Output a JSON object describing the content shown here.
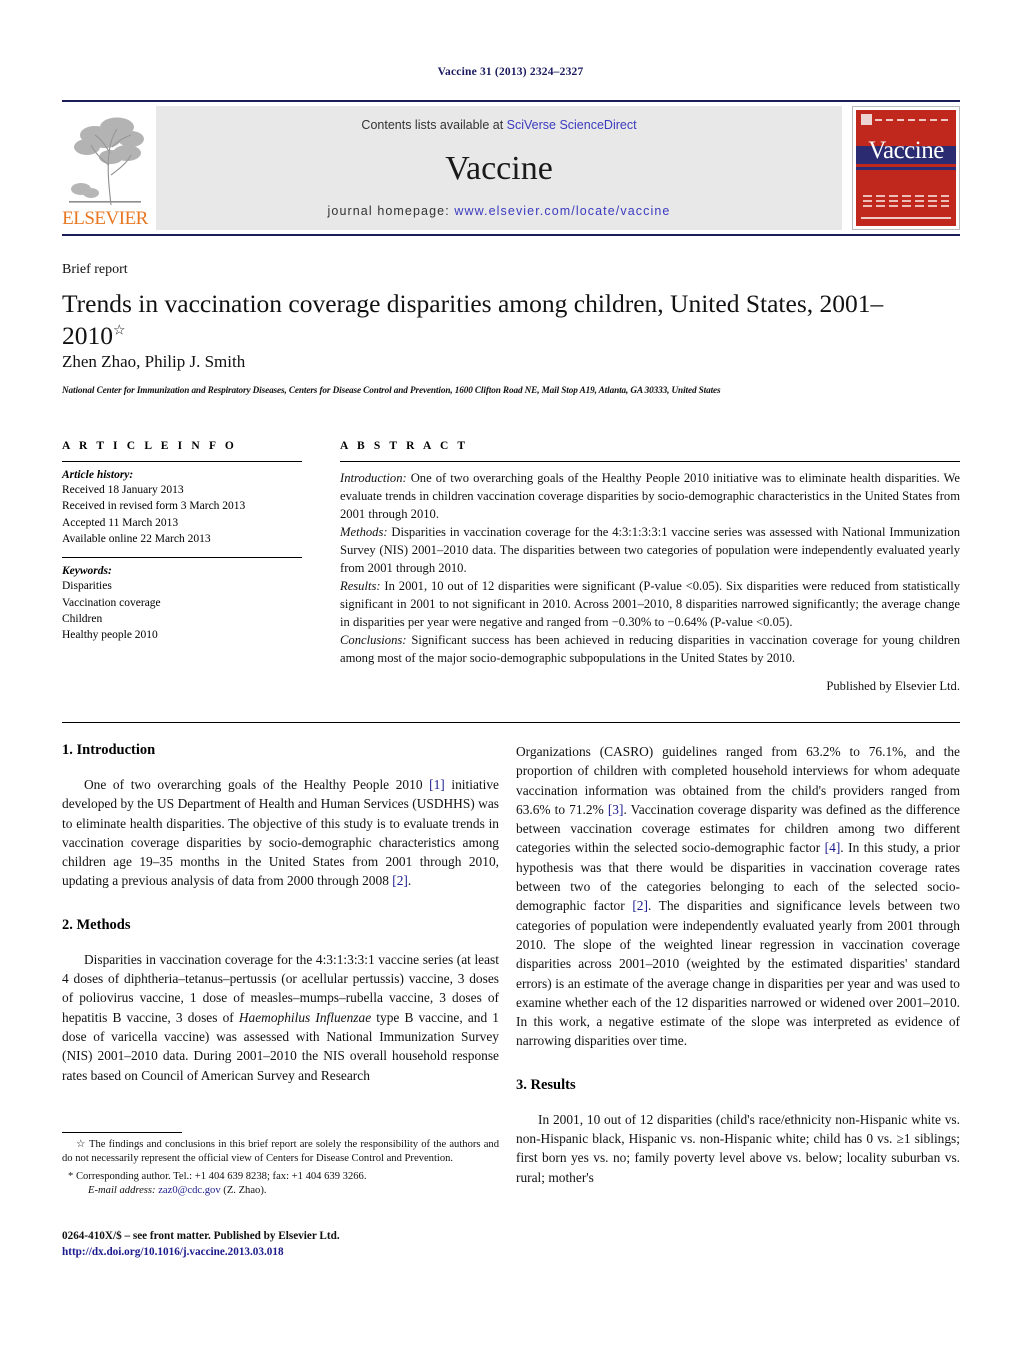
{
  "running_head": "Vaccine 31 (2013) 2324–2327",
  "masthead": {
    "publisher_wordmark": "ELSEVIER",
    "contents_prefix": "Contents lists available at ",
    "contents_link": "SciVerse ScienceDirect",
    "journal_name": "Vaccine",
    "homepage_prefix": "journal homepage: ",
    "homepage_url": "www.elsevier.com/locate/vaccine",
    "cover_title": "Vaccine",
    "accent_red": "#C0281E",
    "accent_navy": "#2b2b72",
    "accent_orange": "#E87722",
    "link_blue": "#3b3bbf"
  },
  "article": {
    "type_label": "Brief report",
    "title": "Trends in vaccination coverage disparities among children, United States, 2001–2010",
    "title_footnote_marker": "☆",
    "authors": "Zhen Zhao, Philip J. Smith",
    "author_marker": "*",
    "affiliation": "National Center for Immunization and Respiratory Diseases, Centers for Disease Control and Prevention, 1600 Clifton Road NE, Mail Stop A19, Atlanta, GA 30333, United States"
  },
  "article_info": {
    "heading": "A R T I C L E   I N F O",
    "history_label": "Article history:",
    "history": [
      "Received 18 January 2013",
      "Received in revised form 3 March 2013",
      "Accepted 11 March 2013",
      "Available online 22 March 2013"
    ],
    "keywords_label": "Keywords:",
    "keywords": [
      "Disparities",
      "Vaccination coverage",
      "Children",
      "Healthy people 2010"
    ]
  },
  "abstract": {
    "heading": "A B S T R A C T",
    "introduction_label": "Introduction:",
    "introduction_text": " One of two overarching goals of the Healthy People 2010 initiative was to eliminate health disparities. We evaluate trends in children vaccination coverage disparities by socio-demographic characteristics in the United States from 2001 through 2010.",
    "methods_label": "Methods:",
    "methods_text": " Disparities in vaccination coverage for the 4:3:1:3:3:1 vaccine series was assessed with National Immunization Survey (NIS) 2001–2010 data. The disparities between two categories of population were independently evaluated yearly from 2001 through 2010.",
    "results_label": "Results:",
    "results_text": " In 2001, 10 out of 12 disparities were significant (P-value <0.05). Six disparities were reduced from statistically significant in 2001 to not significant in 2010. Across 2001–2010, 8 disparities narrowed significantly; the average change in disparities per year were negative and ranged from −0.30% to −0.64% (P-value <0.05).",
    "conclusions_label": "Conclusions:",
    "conclusions_text": " Significant success has been achieved in reducing disparities in vaccination coverage for young children among most of the major socio-demographic subpopulations in the United States by 2010.",
    "publisher_note": "Published by Elsevier Ltd."
  },
  "sections": {
    "introduction_heading": "1.  Introduction",
    "introduction_p1_a": "One of two overarching goals of the Healthy People 2010 ",
    "introduction_ref1": "[1]",
    "introduction_p1_b": " initiative developed by the US Department of Health and Human Services (USDHHS) was to eliminate health disparities. The objective of this study is to evaluate trends in vaccination coverage disparities by socio-demographic characteristics among children age 19–35 months in the United States from 2001 through 2010, updating a previous analysis of data from 2000 through 2008 ",
    "introduction_ref2": "[2]",
    "introduction_p1_c": ".",
    "methods_heading": "2.  Methods",
    "methods_p1_a": "Disparities in vaccination coverage for the 4:3:1:3:3:1 vaccine series (at least 4 doses of diphtheria–tetanus–pertussis (or acellular pertussis) vaccine, 3 doses of poliovirus vaccine, 1 dose of measles–mumps–rubella vaccine, 3 doses of hepatitis B vaccine, 3 doses of ",
    "methods_p1_italic": "Haemophilus Influenzae",
    "methods_p1_b": " type B vaccine, and 1 dose of varicella vaccine) was assessed with National Immunization Survey (NIS) 2001–2010 data. During 2001–2010 the NIS overall household response rates based on Council of American Survey and Research",
    "right_p1_a": "Organizations (CASRO) guidelines ranged from 63.2% to 76.1%, and the proportion of children with completed household interviews for whom adequate vaccination information was obtained from the child's providers ranged from 63.6% to 71.2% ",
    "right_ref3": "[3]",
    "right_p1_b": ". Vaccination coverage disparity was defined as the difference between vaccination coverage estimates for children among two different categories within the selected socio-demographic factor ",
    "right_ref4": "[4]",
    "right_p1_c": ". In this study, a prior hypothesis was that there would be disparities in vaccination coverage rates between two of the categories belonging to each of the selected socio-demographic factor ",
    "right_ref2": "[2]",
    "right_p1_d": ". The disparities and significance levels between two categories of population were independently evaluated yearly from 2001 through 2010. The slope of the weighted linear regression in vaccination coverage disparities across 2001–2010 (weighted by the estimated disparities' standard errors) is an estimate of the average change in disparities per year and was used to examine whether each of the 12 disparities narrowed or widened over 2001–2010. In this work, a negative estimate of the slope was interpreted as evidence of narrowing disparities over time.",
    "results_heading": "3.  Results",
    "results_p1": "In 2001, 10 out of 12 disparities (child's race/ethnicity non-Hispanic white vs. non-Hispanic black, Hispanic vs. non-Hispanic white; child has 0 vs. ≥1 siblings; first born yes vs. no; family poverty level above vs. below; locality suburban vs. rural; mother's"
  },
  "footnotes": {
    "star_marker": "☆",
    "disclaimer": " The findings and conclusions in this brief report are solely the responsibility of the authors and do not necessarily represent the official view of Centers for Disease Control and Prevention.",
    "corresponding_marker": "*",
    "corresponding": " Corresponding author. Tel.: +1 404 639 8238; fax: +1 404 639 3266.",
    "email_label": "E-mail address:",
    "email_address": "zaz0@cdc.gov",
    "email_suffix": " (Z. Zhao).",
    "frontmatter": "0264-410X/$ – see front matter. Published by Elsevier Ltd.",
    "doi": "http://dx.doi.org/10.1016/j.vaccine.2013.03.018"
  }
}
